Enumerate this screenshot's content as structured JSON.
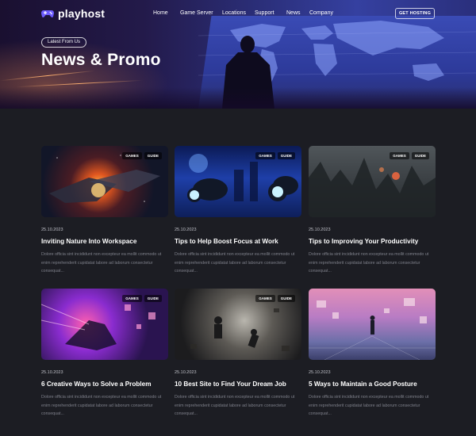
{
  "brand": {
    "name": "playhost",
    "accent": "#6d5cff"
  },
  "nav": {
    "items": [
      "Home",
      "Game Server",
      "Locations",
      "Support",
      "News",
      "Company"
    ],
    "cta": "GET HOSTING"
  },
  "hero": {
    "badge": "Latest From Us",
    "title": "News & Promo"
  },
  "posts": [
    {
      "tags": [
        "GAMES",
        "GUIDE"
      ],
      "date": "25.10.2023",
      "title": "Inviting Nature Into Workspace",
      "excerpt": "Dolore officia sint incididunt non excepteur ea mollit commodo ut enim reprehenderit cupidatat labore ad laborum consectetur consequat...",
      "image": "space-battle"
    },
    {
      "tags": [
        "GAMES",
        "GUIDE"
      ],
      "date": "25.10.2023",
      "title": "Tips to Help Boost Focus at Work",
      "excerpt": "Dolore officia sint incididunt non excepteur ea mollit commodo ut enim reprehenderit cupidatat labore ad laborum consectetur consequat...",
      "image": "motorbike-riders"
    },
    {
      "tags": [
        "GAMES",
        "GUIDE"
      ],
      "date": "25.10.2023",
      "title": "Tips to Improving Your Productivity",
      "excerpt": "Dolore officia sint incididunt non excepteur ea mollit commodo ut enim reprehenderit cupidatat labore ad laborum consectetur consequat...",
      "image": "ruined-city"
    },
    {
      "tags": [
        "GAMES",
        "GUIDE"
      ],
      "date": "25.10.2023",
      "title": "6 Creative Ways to Solve a Problem",
      "excerpt": "Dolore officia sint incididunt non excepteur ea mollit commodo ut enim reprehenderit cupidatat labore ad laborum consectetur consequat...",
      "image": "neon-rider"
    },
    {
      "tags": [
        "GAMES",
        "GUIDE"
      ],
      "date": "25.10.2023",
      "title": "10 Best Site to Find Your Dream Job",
      "excerpt": "Dolore officia sint incididunt non excepteur ea mollit commodo ut enim reprehenderit cupidatat labore ad laborum consectetur consequat...",
      "image": "explosion-fight"
    },
    {
      "tags": [
        "GAMES",
        "GUIDE"
      ],
      "date": "25.10.2023",
      "title": "5 Ways to Maintain a Good Posture",
      "excerpt": "Dolore officia sint incididunt non excepteur ea mollit commodo ut enim reprehenderit cupidatat labore ad laborum consectetur consequat...",
      "image": "floating-cubes"
    }
  ]
}
